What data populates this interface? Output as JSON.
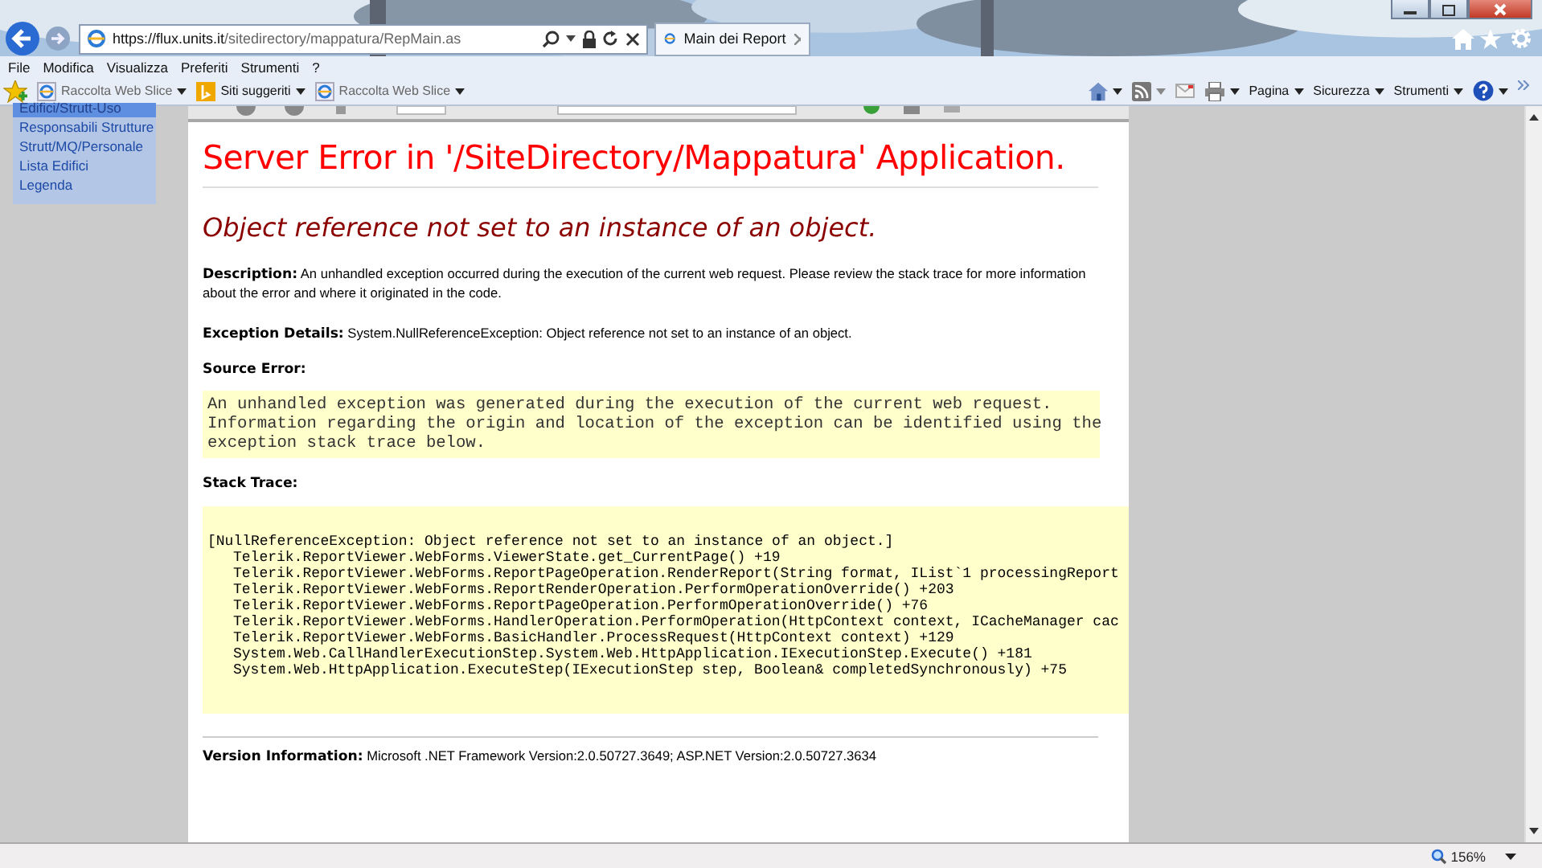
{
  "browser": {
    "address": {
      "domain": "https://flux.units.it",
      "path": "/sitedirectory/mappatura/RepMain.as"
    },
    "tab": {
      "title": "Main dei Report"
    }
  },
  "menu_bar": [
    "File",
    "Modifica",
    "Visualizza",
    "Preferiti",
    "Strumenti",
    "?"
  ],
  "favorites_bar": [
    {
      "label": "Raccolta Web Slice",
      "kind": "slice"
    },
    {
      "label": "Siti suggeriti",
      "kind": "suggested"
    },
    {
      "label": "Raccolta Web Slice",
      "kind": "slice"
    }
  ],
  "command_bar": [
    "Pagina",
    "Sicurezza",
    "Strumenti"
  ],
  "sidebar": {
    "items": [
      {
        "label": "Edifici/Strutt-Uso",
        "selected": true
      },
      {
        "label": "Responsabili Strutture",
        "selected": false
      },
      {
        "label": "Strutt/MQ/Personale",
        "selected": false
      },
      {
        "label": "Lista Edifici",
        "selected": false
      },
      {
        "label": "Legenda",
        "selected": false
      }
    ]
  },
  "error_page": {
    "title": "Server Error in '/SiteDirectory/Mappatura' Application.",
    "subtitle": "Object reference not set to an instance of an object.",
    "description": "**Description:** An unhandled exception occurred during the execution of the current web request. Please review the stack trace for more information about the error and where it originated in the code.",
    "exception_details": "**Exception Details:** System.NullReferenceException: Object reference not set to an instance of an object.",
    "source_error_label": "Source Error:",
    "source_error": [
      "An unhandled exception was generated during the execution of the current web request.",
      "Information regarding the origin and location of the exception can be identified using the",
      "exception stack trace below."
    ],
    "stack_trace_label": "Stack Trace:",
    "stack_trace": {
      "exception": "[NullReferenceException: Object reference not set to an instance of an object.]",
      "frames": [
        "Telerik.ReportViewer.WebForms.ViewerState.get_CurrentPage() +19",
        "Telerik.ReportViewer.WebForms.ReportPageOperation.RenderReport(String format, IList`1 processingReport",
        "Telerik.ReportViewer.WebForms.ReportRenderOperation.PerformOperationOverride() +203",
        "Telerik.ReportViewer.WebForms.ReportPageOperation.PerformOperationOverride() +76",
        "Telerik.ReportViewer.WebForms.HandlerOperation.PerformOperation(HttpContext context, ICacheManager cac",
        "Telerik.ReportViewer.WebForms.BasicHandler.ProcessRequest(HttpContext context) +129",
        "System.Web.CallHandlerExecutionStep.System.Web.HttpApplication.IExecutionStep.Execute() +181",
        "System.Web.HttpApplication.ExecuteStep(IExecutionStep step, Boolean& completedSynchronously) +75"
      ]
    },
    "version_info": "**Version Information:** Microsoft .NET Framework Version:2.0.50727.3649; ASP.NET Version:2.0.50727.3634"
  },
  "status_bar": {
    "zoom": "156%"
  }
}
